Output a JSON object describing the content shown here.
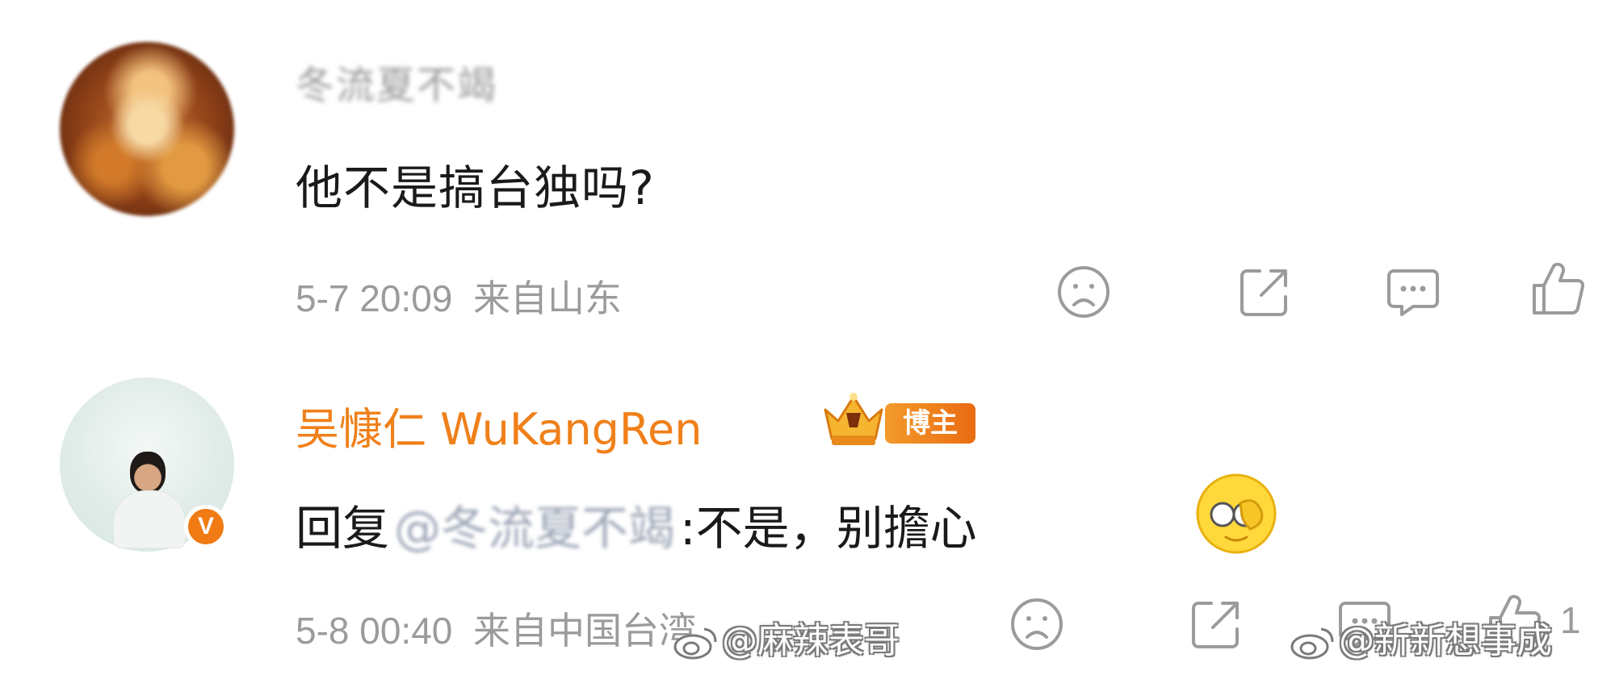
{
  "comments": [
    {
      "username": "冬流夏不竭",
      "text": "他不是搞台独吗?",
      "time": "5-7 20:09",
      "location": "来自山东",
      "avatar_icon": "cat-avatar"
    },
    {
      "username": "吴慷仁 WuKangRen",
      "badge": "博主",
      "reply_prefix": "回复",
      "mention": "@冬流夏不竭",
      "reply_text": ":不是，别擔心",
      "time": "5-8 00:40",
      "location": "来自中国台湾",
      "like_count": "1",
      "verified_mark": "V"
    }
  ],
  "watermarks": {
    "left": "@麻辣表哥",
    "right": "@新新想事成"
  },
  "colors": {
    "username_accent": "#f0801a",
    "badge": "#ea6b12",
    "meta": "#9b9b9b",
    "text": "#1a1a1a"
  }
}
